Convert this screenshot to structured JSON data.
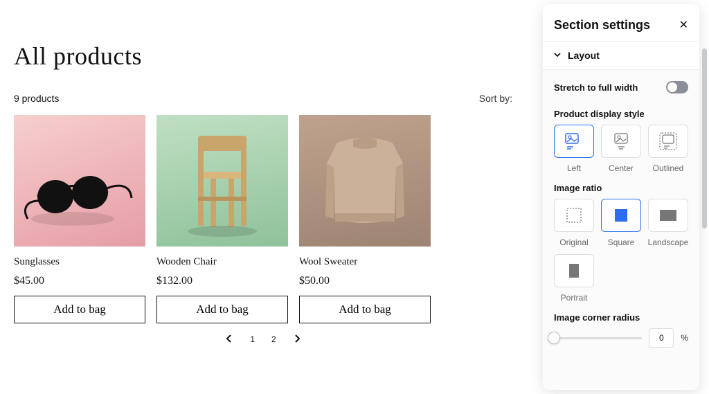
{
  "page": {
    "title": "All products",
    "count_text": "9 products",
    "sort_label": "Sort by:"
  },
  "products": [
    {
      "name": "Sunglasses",
      "price": "$45.00",
      "btn": "Add to bag",
      "bg": "#f2b9bc"
    },
    {
      "name": "Wooden Chair",
      "price": "$132.00",
      "btn": "Add to bag",
      "bg": "#a8d2b0"
    },
    {
      "name": "Wool Sweater",
      "price": "$50.00",
      "btn": "Add to bag",
      "bg": "#b09682"
    }
  ],
  "pagination": {
    "prev": "‹",
    "next": "›",
    "pages": [
      "1",
      "2"
    ]
  },
  "sidebar": {
    "title": "Section settings",
    "accordion": "Layout",
    "stretch_label": "Stretch to full width",
    "stretch_on": false,
    "display_style": {
      "label": "Product display style",
      "options": [
        "Left",
        "Center",
        "Outlined"
      ],
      "selected": "Left"
    },
    "ratio": {
      "label": "Image ratio",
      "options": [
        "Original",
        "Square",
        "Landscape",
        "Portrait"
      ],
      "selected": "Square"
    },
    "radius": {
      "label": "Image corner radius",
      "value": "0",
      "unit": "%"
    }
  }
}
